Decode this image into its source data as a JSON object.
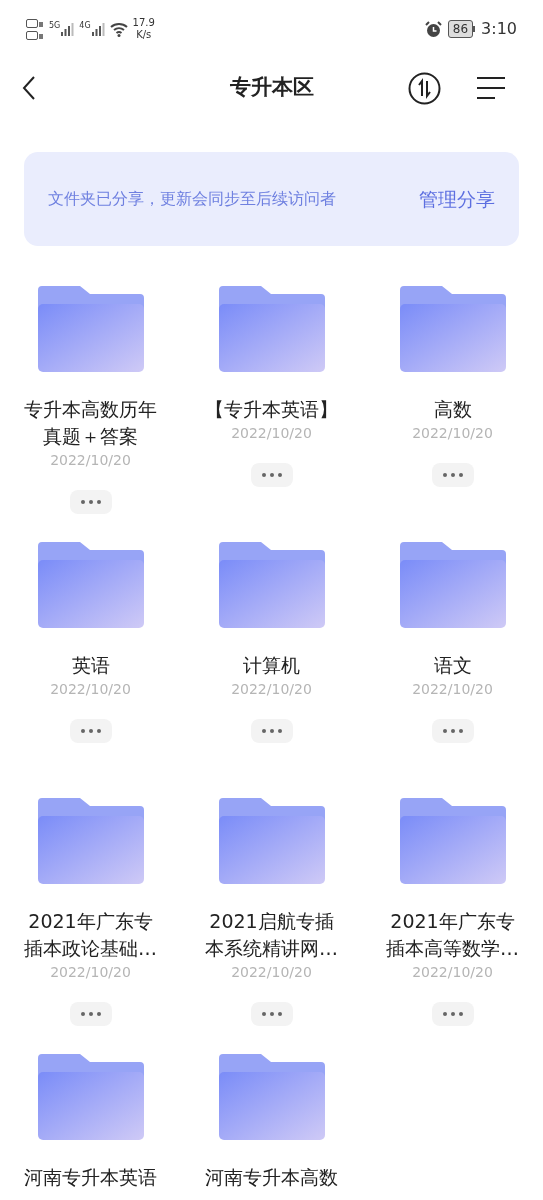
{
  "status_bar": {
    "sim_1_network": "5G",
    "sim_2_network": "4G",
    "network_speed": "17.9",
    "speed_unit": "K/s",
    "battery": "86",
    "time": "3:10"
  },
  "header": {
    "title": "专升本区"
  },
  "share_banner": {
    "message": "文件夹已分享，更新会同步至后续访问者",
    "action": "管理分享"
  },
  "folders": [
    {
      "name_lines": [
        "专升本高数历年",
        "真题＋答案"
      ],
      "date": "2022/10/20"
    },
    {
      "name_lines": [
        "【专升本英语】"
      ],
      "date": "2022/10/20"
    },
    {
      "name_lines": [
        "高数"
      ],
      "date": "2022/10/20"
    },
    {
      "name_lines": [
        "英语"
      ],
      "date": "2022/10/20"
    },
    {
      "name_lines": [
        "计算机"
      ],
      "date": "2022/10/20"
    },
    {
      "name_lines": [
        "语文"
      ],
      "date": "2022/10/20"
    },
    {
      "name_lines": [
        "2021年广东专",
        "插本政论基础…"
      ],
      "date": "2022/10/20"
    },
    {
      "name_lines": [
        "2021启航专插",
        "本系统精讲网…"
      ],
      "date": "2022/10/20"
    },
    {
      "name_lines": [
        "2021年广东专",
        "插本高等数学…"
      ],
      "date": "2022/10/20"
    },
    {
      "name_lines": [
        "河南专升本英语"
      ]
    },
    {
      "name_lines": [
        "河南专升本高数"
      ]
    }
  ]
}
